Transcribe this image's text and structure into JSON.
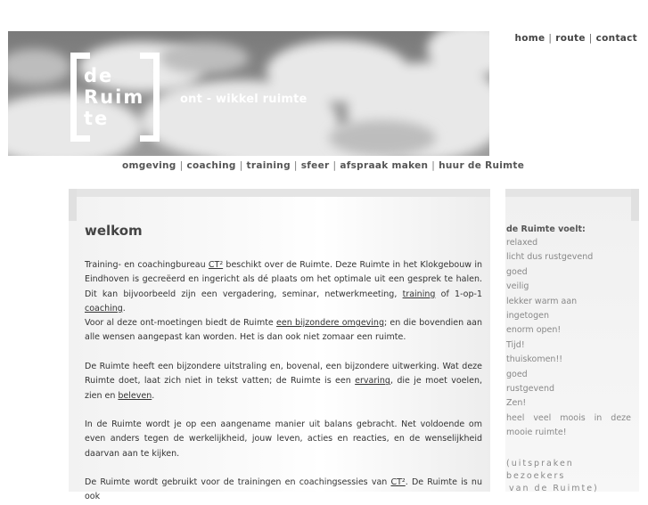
{
  "topnav": {
    "items": [
      "home",
      "route",
      "contact"
    ]
  },
  "banner": {
    "logo": {
      "line1": "de",
      "line2": "Ruim",
      "line3": "te"
    },
    "tagline": "ont - wikkel ruimte"
  },
  "mainnav": {
    "items": [
      "omgeving",
      "coaching",
      "training",
      "sfeer",
      "afspraak maken",
      "huur de Ruimte"
    ]
  },
  "content": {
    "title": "welkom",
    "p1": {
      "t1": "Training- en coachingbureau ",
      "l1": "CT²",
      "t2": " beschikt over de Ruimte. Deze Ruimte in het Klokgebouw in Eindhoven is gecreëerd en ingericht als dé plaats om het optimale uit een gesprek te halen. Dit kan bijvoorbeeld zijn een vergadering, seminar, netwerkmeeting, ",
      "l2": "training",
      "t3": " of 1-op-1 ",
      "l3": "coaching",
      "t4": "."
    },
    "p2": {
      "t1": "Voor al deze ont-moetingen biedt de Ruimte ",
      "l1": "een bijzondere omgeving",
      "t2": "; en die bovendien aan alle wensen aangepast kan worden. Het is dan ook niet zomaar een ruimte."
    },
    "p3": {
      "t1": "De Ruimte heeft een bijzondere uitstraling en, bovenal, een bijzondere uitwerking. Wat deze Ruimte doet, laat zich niet in tekst vatten; de Ruimte is een ",
      "l1": "ervaring",
      "t2": ", die je moet voelen, zien en ",
      "l2": "beleven",
      "t3": "."
    },
    "p4": "In de Ruimte wordt je op een aangename manier uit balans gebracht. Net voldoende om even anders tegen de werkelijkheid, jouw leven, acties en reacties, en de wenselijkheid daarvan aan te kijken.",
    "p5": {
      "t1": "De Ruimte wordt gebruikt voor de trainingen en coachingsessies van ",
      "l1": "CT²",
      "t2": ". De Ruimte is nu ook"
    }
  },
  "sidebar": {
    "title": "de Ruimte voelt:",
    "items": [
      "relaxed",
      "licht dus rustgevend",
      "goed",
      "veilig",
      "lekker warm aan",
      "ingetogen",
      "enorm open!",
      "Tijd!",
      "thuiskomen!!",
      "goed",
      "rustgevend",
      "Zen!",
      "heel veel moois in deze mooie ruimte!"
    ],
    "footnote_line1": "(uitspraken bezoekers",
    "footnote_line2": "van de Ruimte)"
  },
  "colors": {
    "text": "#333333",
    "nav": "#555555",
    "sidebar_text": "#888888",
    "banner_bg": "#8f8f8f"
  }
}
